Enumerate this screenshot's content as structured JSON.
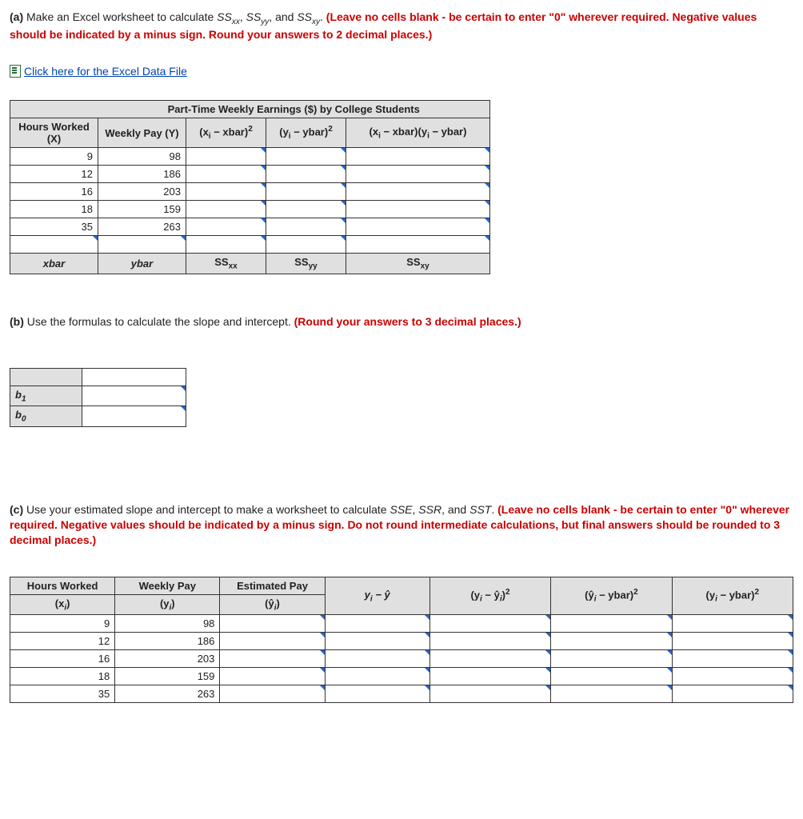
{
  "part_a": {
    "label": "(a)",
    "text": "Make an Excel worksheet to calculate ",
    "ss1": "SS",
    "sub1": "xx",
    "ss2": "SS",
    "sub2": "yy",
    "ss3": "SS",
    "sub3": "xy",
    "after": ". ",
    "red": "(Leave no cells blank - be certain to enter \"0\" wherever required. Negative values should be indicated by a minus sign. Round your answers to 2 decimal places.)"
  },
  "link_text": "Click here for the Excel Data File",
  "table_a": {
    "title": "Part-Time Weekly Earnings ($) by College Students",
    "h1a": "Hours Worked",
    "h1b": "(X)",
    "h2": "Weekly Pay (Y)",
    "h3_a": "(x",
    "h3_b": "i",
    "h3_c": " − xbar)",
    "h3_d": "2",
    "h4_a": "(y",
    "h4_b": "i",
    "h4_c": " − ybar)",
    "h4_d": "2",
    "h5_a": "(x",
    "h5_b": "i",
    "h5_c": " − xbar)(y",
    "h5_d": "i",
    "h5_e": " − ybar)",
    "rows": [
      {
        "x": "9",
        "y": "98"
      },
      {
        "x": "12",
        "y": "186"
      },
      {
        "x": "16",
        "y": "203"
      },
      {
        "x": "18",
        "y": "159"
      },
      {
        "x": "35",
        "y": "263"
      }
    ],
    "sum_h1": "xbar",
    "sum_h2": "ybar",
    "sum_h3a": "SS",
    "sum_h3b": "xx",
    "sum_h4a": "SS",
    "sum_h4b": "yy",
    "sum_h5a": "SS",
    "sum_h5b": "xy"
  },
  "part_b": {
    "label": "(b)",
    "text": "Use the formulas to calculate the slope and intercept. ",
    "red": "(Round your answers to 3 decimal places.)"
  },
  "table_b": {
    "r1a": "b",
    "r1b": "1",
    "r2a": "b",
    "r2b": "0"
  },
  "part_c": {
    "label": "(c)",
    "text1": "Use your estimated slope and intercept to make a worksheet to calculate ",
    "i1": "SSE",
    "t2": ", ",
    "i2": "SSR",
    "t3": ", and ",
    "i3": "SST",
    "t4": ". ",
    "red": "(Leave no cells blank - be certain to enter \"0\" wherever required. Negative values should be indicated by a minus sign. Do not round intermediate calculations, but final answers should be rounded to 3 decimal places.)"
  },
  "table_c": {
    "h1a": "Hours Worked",
    "h1b_a": "(x",
    "h1b_b": "i",
    "h1b_c": ")",
    "h2a": "Weekly Pay",
    "h2b_a": "(y",
    "h2b_b": "i",
    "h2b_c": ")",
    "h3a": "Estimated Pay",
    "h3b_a": "(ŷ",
    "h3b_b": "i",
    "h3b_c": ")",
    "h4_a": "y",
    "h4_b": "i",
    "h4_c": " − ŷ",
    "h5_a": "(y",
    "h5_b": "i",
    "h5_c": " − ŷ",
    "h5_d": "i",
    "h5_e": ")",
    "h5_f": "2",
    "h6_a": "(ŷ",
    "h6_b": "i",
    "h6_c": " − ybar)",
    "h6_d": "2",
    "h7_a": "(y",
    "h7_b": "i",
    "h7_c": " − ybar)",
    "h7_d": "2",
    "rows": [
      {
        "x": "9",
        "y": "98"
      },
      {
        "x": "12",
        "y": "186"
      },
      {
        "x": "16",
        "y": "203"
      },
      {
        "x": "18",
        "y": "159"
      },
      {
        "x": "35",
        "y": "263"
      }
    ]
  }
}
